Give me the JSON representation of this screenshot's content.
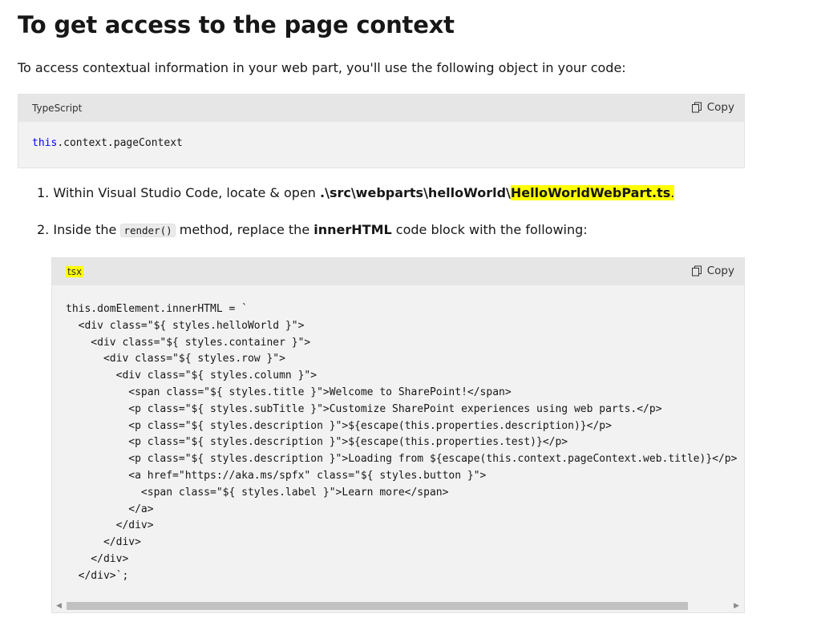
{
  "heading": "To get access to the page context",
  "intro": "To access contextual information in your web part, you'll use the following object in your code:",
  "code_block_1": {
    "language": "TypeScript",
    "copy_label": "Copy",
    "keyword": "this",
    "rest": ".context.pageContext"
  },
  "steps": [
    {
      "number": "1.",
      "text_before": "Within Visual Studio Code, locate & open ",
      "path_bold": ".\\src\\webparts\\helloWorld\\",
      "file_highlight": "HelloWorldWebPart.ts",
      "text_after": "."
    },
    {
      "number": "2.",
      "text_before": "Inside the ",
      "code": "render()",
      "text_middle": " method, replace the ",
      "bold": "innerHTML",
      "text_after": " code block with the following:"
    }
  ],
  "code_block_2": {
    "language": "tsx",
    "copy_label": "Copy",
    "code": "this.domElement.innerHTML = `\n  <div class=\"${ styles.helloWorld }\">\n    <div class=\"${ styles.container }\">\n      <div class=\"${ styles.row }\">\n        <div class=\"${ styles.column }\">\n          <span class=\"${ styles.title }\">Welcome to SharePoint!</span>\n          <p class=\"${ styles.subTitle }\">Customize SharePoint experiences using web parts.</p>\n          <p class=\"${ styles.description }\">${escape(this.properties.description)}</p>\n          <p class=\"${ styles.description }\">${escape(this.properties.test)}</p>\n          <p class=\"${ styles.description }\">Loading from ${escape(this.context.pageContext.web.title)}</p>\n          <a href=\"https://aka.ms/spfx\" class=\"${ styles.button }\">\n            <span class=\"${ styles.label }\">Learn more</span>\n          </a>\n        </div>\n      </div>\n    </div>\n  </div>`;"
  },
  "colors": {
    "keyword": "#0101fd",
    "highlight": "#ffff00",
    "code_bg": "#f2f2f2",
    "code_header_bg": "#e6e6e6"
  }
}
